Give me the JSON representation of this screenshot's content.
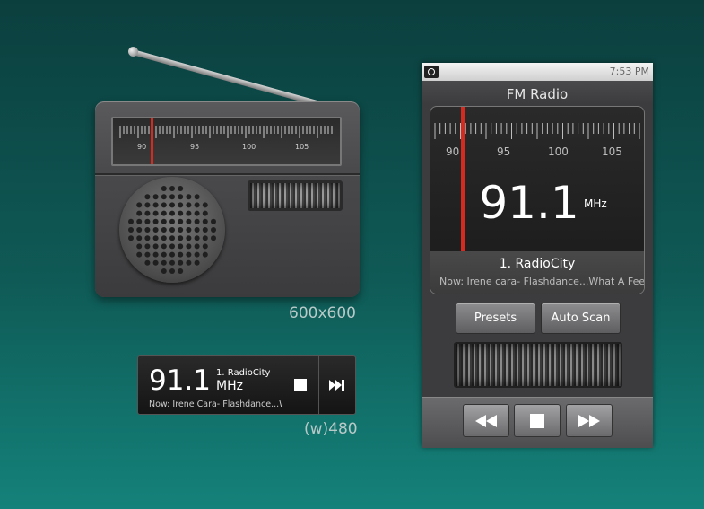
{
  "radio_icon": {
    "dial_ticks": [
      "90",
      "95",
      "100",
      "105"
    ],
    "size_caption": "600x600"
  },
  "widget": {
    "frequency": "91.1",
    "station": "1. RadioCity",
    "unit": "MHz",
    "song": "Now: Irene Cara- Flashdance...What A Feeling",
    "size_caption": "(w)480",
    "stop_icon": "stop-icon",
    "next_icon": "next-icon"
  },
  "phone": {
    "status_time": "7:53 PM",
    "title": "FM Radio",
    "dial_ticks": [
      "90",
      "95",
      "100",
      "105"
    ],
    "frequency": "91.1",
    "unit": "MHz",
    "station": "1. RadioCity",
    "song": "Now: Irene cara- Flashdance...What A Feeling",
    "presets_label": "Presets",
    "auto_scan_label": "Auto Scan",
    "controls": [
      "rewind-icon",
      "stop-icon",
      "fast-forward-icon"
    ]
  },
  "colors": {
    "background_top": "#0b3f3e",
    "background_bottom": "#14827a",
    "needle": "#d42a20"
  }
}
